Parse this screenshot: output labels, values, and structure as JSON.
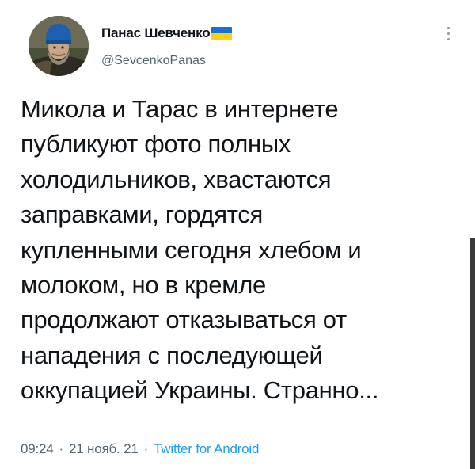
{
  "author": {
    "display_name": "Панас Шевченко",
    "handle": "@SevcenkoPanas",
    "avatar_icon": "portrait-avatar",
    "flag_icon": "ukraine-flag-icon",
    "flag_colors": {
      "top": "#1a6fd6",
      "bottom": "#f6d20f"
    }
  },
  "tweet": {
    "lines": [
      "Микола и Тарас в интернете",
      "публикуют фото полных",
      "холодильников, хвастаются",
      "заправками, гордятся",
      "купленными сегодня хлебом и",
      "молоком, но в кремле",
      "продолжают отказываться от",
      "нападения с последующей",
      "оккупацией Украины. Странно..."
    ],
    "time": "09:24",
    "date": "21 нояб. 21",
    "separator": "·",
    "source": "Twitter for Android"
  },
  "colors": {
    "text": "#0f1419",
    "secondary": "#536471",
    "link": "#1d9bf0"
  },
  "icons": {
    "more": "more-vertical-icon"
  }
}
